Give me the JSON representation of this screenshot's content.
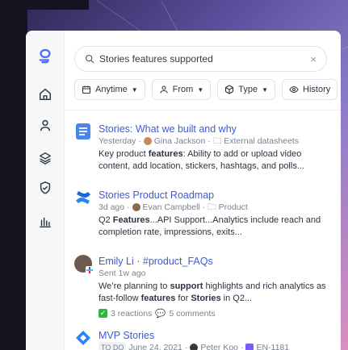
{
  "search": {
    "query": "Stories features supported",
    "clear_label": "×"
  },
  "filters": [
    {
      "label": "Anytime"
    },
    {
      "label": "From"
    },
    {
      "label": "Type"
    },
    {
      "label": "History"
    }
  ],
  "results": [
    {
      "title": "Stories: What we built and why",
      "meta_time": "Yesterday ·",
      "meta_author": "Gina Jackson ·",
      "meta_location": "External datasheets",
      "snippet_parts": [
        "Key product ",
        "features",
        ": Ability to add or upload video content, add location, stickers, hashtags, and polls..."
      ]
    },
    {
      "title": "Stories Product Roadmap",
      "meta_time": "3d ago ·",
      "meta_author": "Evan Campbell ·",
      "meta_location": "Product",
      "snippet_parts": [
        "Q2 ",
        "Features",
        "...API Support...Analytics include reach and completion rate, impressions, exits..."
      ]
    },
    {
      "title": "Emily Li · #product_FAQs",
      "meta_time": "Sent 1w ago",
      "snippet_parts": [
        "We’re planning to ",
        "support",
        " highlights and rich analytics as fast-follow ",
        "features",
        " for ",
        "Stories",
        " in Q2..."
      ],
      "reactions": "3 reactions",
      "comments": "5 comments"
    },
    {
      "title": "MVP Stories",
      "meta_tag": "TO DO",
      "meta_time": "June 24, 2021 ·",
      "meta_author": "Peter Koo ·",
      "meta_location": "EN-1181"
    }
  ],
  "colors": {
    "accent": "#3b5bdb",
    "rail_bg": "#f6f7f9",
    "logo": "#4c6ef5"
  }
}
